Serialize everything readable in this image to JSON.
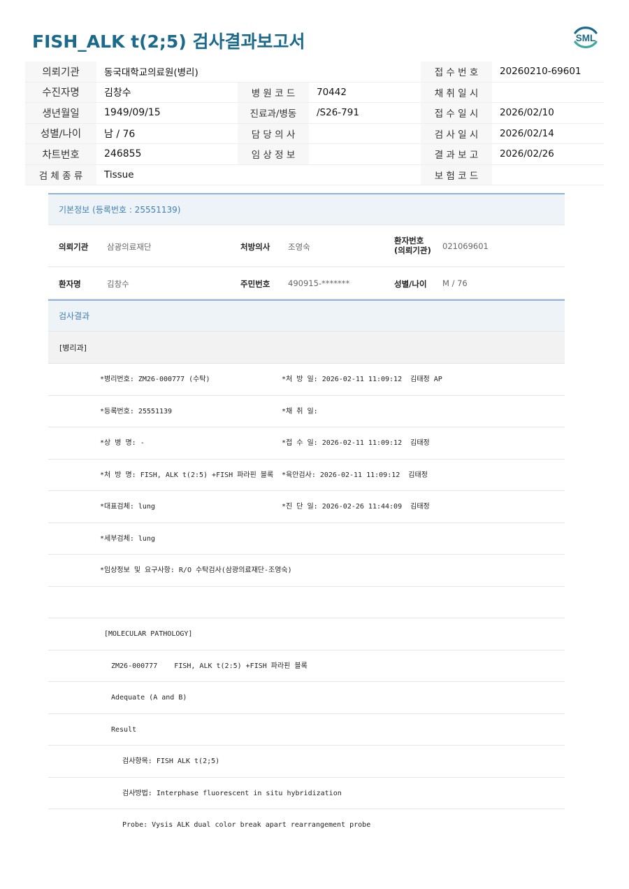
{
  "title": "FISH_ALK t(2;5) 검사결과보고서",
  "logo_text": "SML",
  "colors": {
    "title": "#1b6a8c",
    "section_text": "#3d7fb8",
    "section_bg": "#eef3f8"
  },
  "header": {
    "r1": {
      "l1": "의뢰기관",
      "v1": "동국대학교의료원(병리)",
      "l3": "접 수 번 호",
      "v3": "20260210-69601"
    },
    "r2": {
      "l1": "수진자명",
      "v1": "김창수",
      "l2": "병 원 코 드",
      "v2": "70442",
      "l3": "채 취 일 시",
      "v3": ""
    },
    "r3": {
      "l1": "생년월일",
      "v1": "1949/09/15",
      "l2": "진료과/병동",
      "v2": "/S26-791",
      "l3": "접 수 일 시",
      "v3": "2026/02/10"
    },
    "r4": {
      "l1": "성별/나이",
      "v1": "남 / 76",
      "l2": "담 당 의 사",
      "v2": "",
      "l3": "검 사 일 시",
      "v3": "2026/02/14"
    },
    "r5": {
      "l1": "차트번호",
      "v1": "246855",
      "l2": "임 상 정 보",
      "v2": "",
      "l3": "결 과 보 고",
      "v3": "2026/02/26"
    },
    "r6": {
      "l1": "검 체 종 류",
      "v1": "Tissue",
      "l3": "보 험 코 드",
      "v3": ""
    }
  },
  "basic": {
    "title": "기본정보",
    "reg_note": "(등록번호 : 25551139)",
    "row1": {
      "k1": "의뢰기관",
      "v1": "삼광의료재단",
      "k2": "처방의사",
      "v2": "조영숙",
      "k3a": "환자번호",
      "k3b": "(의뢰기관)",
      "v3": "021069601"
    },
    "row2": {
      "k1": "환자명",
      "v1": "김창수",
      "k2": "주민번호",
      "v2": "490915-*******",
      "k3": "성별/나이",
      "v3": "M / 76"
    }
  },
  "result": {
    "title": "검사결과",
    "dept": "[병리과]",
    "rows": [
      {
        "a": "*병리번호: ZM26-000777 (수탁)",
        "b": "*처 방 일: 2026-02-11 11:09:12  김태정 AP"
      },
      {
        "a": "*등록번호: 25551139",
        "b": "*채 취 일:"
      },
      {
        "a": "*상 병 명: -",
        "b": "*접 수 일: 2026-02-11 11:09:12  김태정"
      },
      {
        "a": "*처 방 명: FISH, ALK t(2:5) +FISH 파라핀 블록",
        "b": "*육안검사: 2026-02-11 11:09:12  김태정"
      },
      {
        "a": "*대표검체: lung",
        "b": "*진 단 일: 2026-02-26 11:44:09  김태정"
      },
      {
        "a": "*세부검체: lung",
        "b": ""
      },
      {
        "a": "*임상정보 및 요구사항: R/O 수탁검사(삼광의료재단-조영숙)",
        "b": ""
      }
    ],
    "mol": [
      "[MOLECULAR PATHOLOGY]",
      "ZM26-000777    FISH, ALK t(2:5) +FISH 파라핀 블록",
      "Adequate (A and B)",
      "Result",
      "검사항목: FISH ALK t(2;5)",
      "검사방법: Interphase fluorescent in situ hybridization",
      "Probe: Vysis ALK dual color break apart rearrangement probe"
    ]
  }
}
